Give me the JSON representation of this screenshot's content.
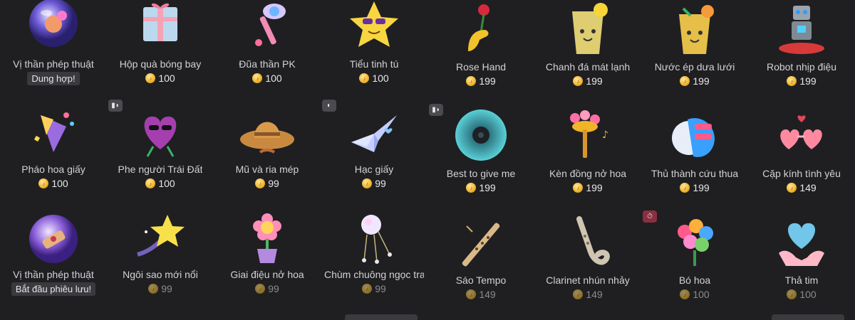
{
  "left_panel": {
    "rows": [
      [
        {
          "name": "Vị thần phép thuật",
          "tag": "Dung hợp!",
          "icon": "magic-orb-icon"
        },
        {
          "name": "Hộp quà bóng bay",
          "price": "100",
          "icon": "gift-box-icon"
        },
        {
          "name": "Đũa thần PK",
          "price": "100",
          "icon": "magic-wand-icon"
        },
        {
          "name": "Tiểu tinh tú",
          "price": "100",
          "icon": "star-sunglasses-icon"
        }
      ],
      [
        {
          "name": "Pháo hoa giấy",
          "price": "100",
          "icon": "party-popper-icon"
        },
        {
          "name": "Phe người Trái Đất",
          "price": "100",
          "icon": "heart-sunglasses-icon",
          "badge": "video-icon"
        },
        {
          "name": "Mũ và ria mép",
          "price": "99",
          "icon": "cowboy-hat-icon"
        },
        {
          "name": "Hạc giấy",
          "price": "99",
          "icon": "paper-crane-icon",
          "badge": "palette-icon"
        }
      ],
      [
        {
          "name": "Vị thần phép thuật",
          "tag": "Bắt đầu phiêu lưu!",
          "icon": "scroll-orb-icon"
        },
        {
          "name": "Ngôi sao mới nổi",
          "price": "99",
          "icon": "shooting-star-icon"
        },
        {
          "name": "Giai điệu nở hoa",
          "price": "99",
          "icon": "flower-pot-icon"
        },
        {
          "name": "Chùm chuông ngọc tra",
          "price": "99",
          "icon": "wind-chime-icon"
        }
      ]
    ]
  },
  "right_panel": {
    "rows": [
      [
        {
          "name": "Rose Hand",
          "price": "199",
          "icon": "rose-hand-icon"
        },
        {
          "name": "Chanh đá mát lạnh",
          "price": "199",
          "icon": "lemonade-icon"
        },
        {
          "name": "Nước ép dưa lưới",
          "price": "199",
          "icon": "melon-juice-icon"
        },
        {
          "name": "Robot nhịp điệu",
          "price": "199",
          "icon": "robot-icon"
        }
      ],
      [
        {
          "name": "Best to give me",
          "price": "199",
          "icon": "vinyl-disc-icon",
          "badge": "video-icon"
        },
        {
          "name": "Kèn đồng nở hoa",
          "price": "199",
          "icon": "trumpet-flowers-icon"
        },
        {
          "name": "Thủ thành cứu thua",
          "price": "199",
          "icon": "goalkeeper-glove-icon"
        },
        {
          "name": "Cặp kính tình yêu",
          "price": "149",
          "icon": "heart-glasses-icon"
        }
      ],
      [
        {
          "name": "Sáo Tempo",
          "price": "149",
          "icon": "flute-icon"
        },
        {
          "name": "Clarinet nhún nhảy",
          "price": "149",
          "icon": "clarinet-icon"
        },
        {
          "name": "Bó hoa",
          "price": "100",
          "icon": "bouquet-icon",
          "badge": "timer-icon"
        },
        {
          "name": "Thả tim",
          "price": "100",
          "icon": "heart-hands-icon"
        }
      ]
    ]
  },
  "colors": {
    "background": "#1f1f22",
    "coin": "#f0b429",
    "badge": "#4a4a4f",
    "badge_red": "#8a2f3f"
  }
}
